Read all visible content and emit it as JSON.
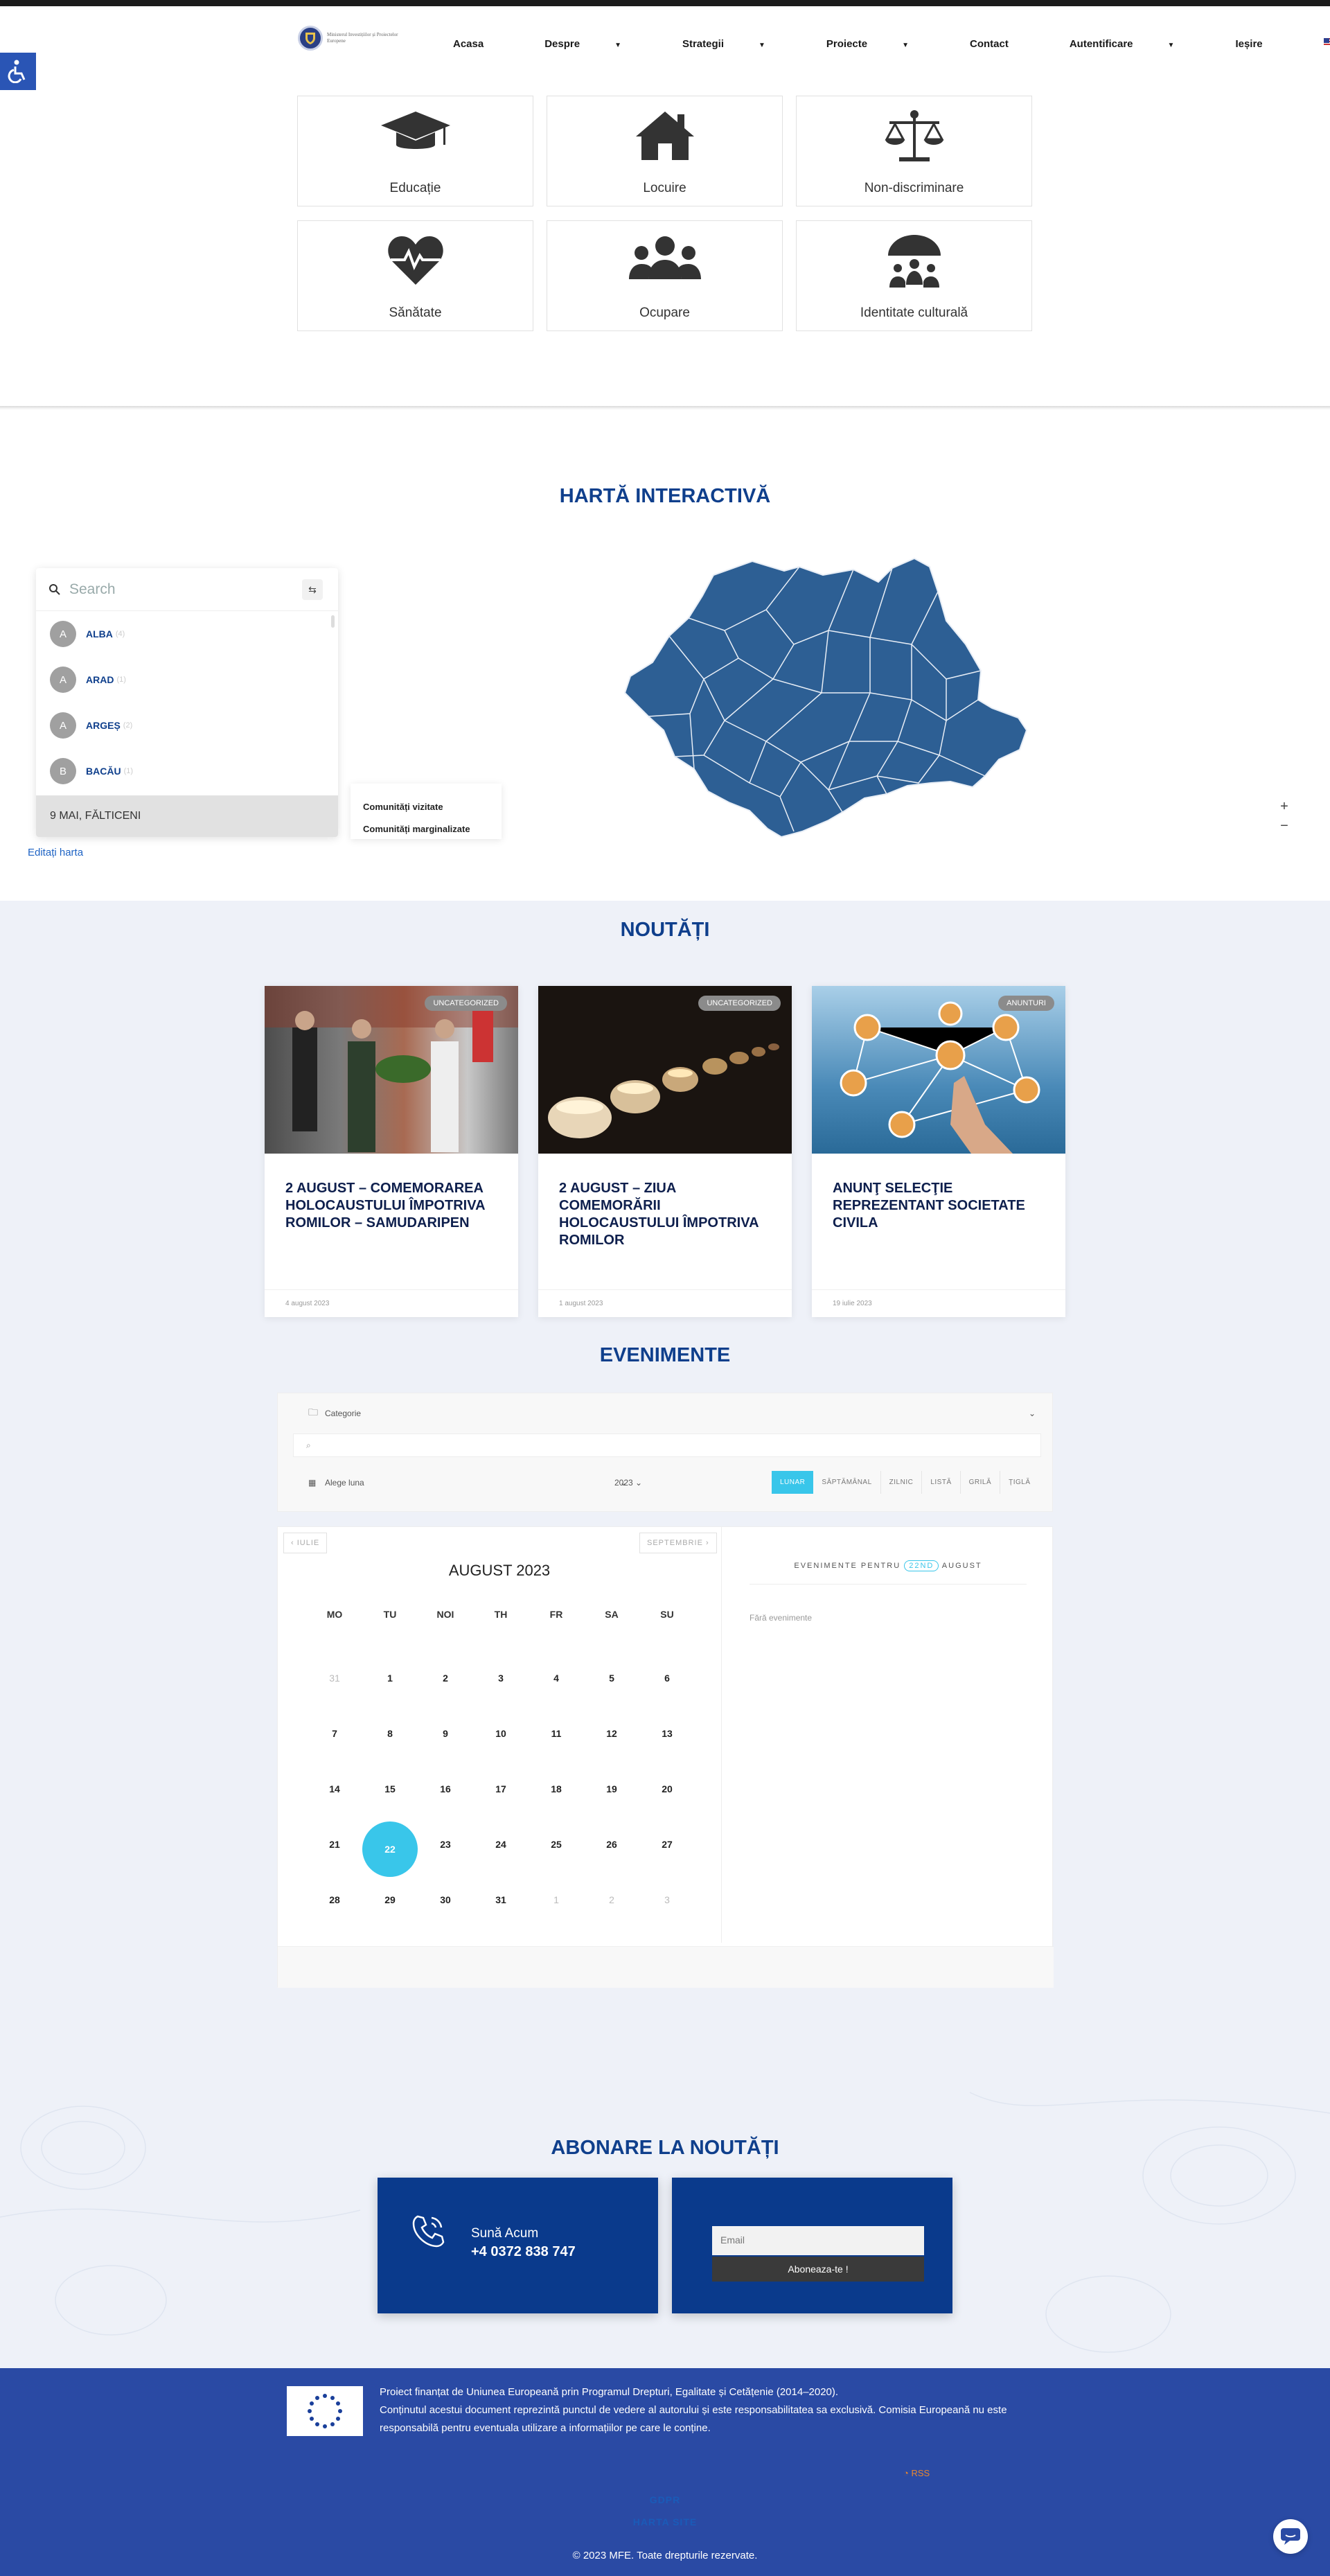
{
  "header": {
    "logo_text": "Ministerul Investițiilor și Proiectelor Europene",
    "nav": [
      {
        "label": "Acasa",
        "dropdown": false
      },
      {
        "label": "Despre",
        "dropdown": true
      },
      {
        "label": "Strategii",
        "dropdown": true
      },
      {
        "label": "Proiecte",
        "dropdown": true
      },
      {
        "label": "Contact",
        "dropdown": false
      },
      {
        "label": "Autentificare",
        "dropdown": true
      },
      {
        "label": "Ieșire",
        "dropdown": false
      }
    ],
    "language_icon": "us-flag-icon"
  },
  "categories": [
    {
      "label": "Educație",
      "icon": "graduation-cap-icon"
    },
    {
      "label": "Locuire",
      "icon": "house-icon"
    },
    {
      "label": "Non-discriminare",
      "icon": "balance-scale-icon"
    },
    {
      "label": "Sănătate",
      "icon": "heartbeat-icon"
    },
    {
      "label": "Ocupare",
      "icon": "users-icon"
    },
    {
      "label": "Identitate culturală",
      "icon": "umbrella-people-icon"
    }
  ],
  "map": {
    "title": "HARTĂ INTERACTIVĂ",
    "search_placeholder": "Search",
    "counties": [
      {
        "initial": "A",
        "name": "ALBA",
        "count": "(4)"
      },
      {
        "initial": "A",
        "name": "ARAD",
        "count": "(1)"
      },
      {
        "initial": "A",
        "name": "ARGEȘ",
        "count": "(2)"
      },
      {
        "initial": "B",
        "name": "BACĂU",
        "count": "(1)"
      }
    ],
    "selected_item": "9 MAI, FĂLTICENI",
    "legend": [
      "Comunități vizitate",
      "Comunități marginalizate"
    ],
    "edit_link": "Editați harta",
    "zoom_in": "+",
    "zoom_out": "−",
    "map_color": "#2d5f94"
  },
  "news": {
    "title": "NOUTĂȚI",
    "items": [
      {
        "badge": "UNCATEGORIZED",
        "title": "2 AUGUST – COMEMORAREA HOLOCAUSTULUI ÎMPOTRIVA ROMILOR – SAMUDARIPEN",
        "date": "4 august 2023"
      },
      {
        "badge": "UNCATEGORIZED",
        "title": "2 AUGUST – ZIUA COMEMORĂRII HOLOCAUSTULUI ÎMPOTRIVA ROMILOR",
        "date": "1 august 2023"
      },
      {
        "badge": "ANUNTURI",
        "title": "ANUNŢ SELECŢIE REPREZENTANT SOCIETATE CIVILA",
        "date": "19 iulie 2023"
      }
    ]
  },
  "events": {
    "title": "EVENIMENTE",
    "category_placeholder": "Categorie",
    "month_select": "Alege luna",
    "year_select": "2023",
    "views": [
      "LUNAR",
      "SĂPTĂMÂNAL",
      "ZILNIC",
      "LISTĂ",
      "GRILĂ",
      "ȚIGLĂ"
    ],
    "active_view": "LUNAR",
    "prev_month": "IULIE",
    "next_month": "SEPTEMBRIE",
    "month_title": "AUGUST 2023",
    "weekdays": [
      "MO",
      "TU",
      "NOI",
      "TH",
      "FR",
      "SA",
      "SU"
    ],
    "weeks": [
      [
        "31",
        "1",
        "2",
        "3",
        "4",
        "5",
        "6"
      ],
      [
        "7",
        "8",
        "9",
        "10",
        "11",
        "12",
        "13"
      ],
      [
        "14",
        "15",
        "16",
        "17",
        "18",
        "19",
        "20"
      ],
      [
        "21",
        "22",
        "23",
        "24",
        "25",
        "26",
        "27"
      ],
      [
        "28",
        "29",
        "30",
        "31",
        "1",
        "2",
        "3"
      ]
    ],
    "today": "22",
    "side_heading_pre": "EVENIMENTE PENTRU",
    "side_heading_date": "22ND",
    "side_heading_post": "AUGUST",
    "no_events": "Fără evenimente"
  },
  "newsletter": {
    "title": "ABONARE LA NOUTĂȚI",
    "call_label": "Sună Acum",
    "phone": "+4 0372 838 747",
    "email_placeholder": "Email",
    "subscribe_button": "Aboneaza-te !"
  },
  "footer": {
    "text_1": "Proiect finanțat de Uniunea Europeană prin Programul Drepturi, Egalitate și Cetățenie (2014–2020).",
    "text_2": "Conținutul acestui document reprezintă punctul de vedere al autorului și este responsabilitatea sa exclusivă. Comisia Europeană nu este responsabilă pentru eventuala utilizare a informațiilor pe care le conține.",
    "rss": "RSS",
    "links": [
      "GDPR",
      "HARTA SITE"
    ],
    "copyright": "© 2023 MFE. Toate drepturile rezervate."
  }
}
